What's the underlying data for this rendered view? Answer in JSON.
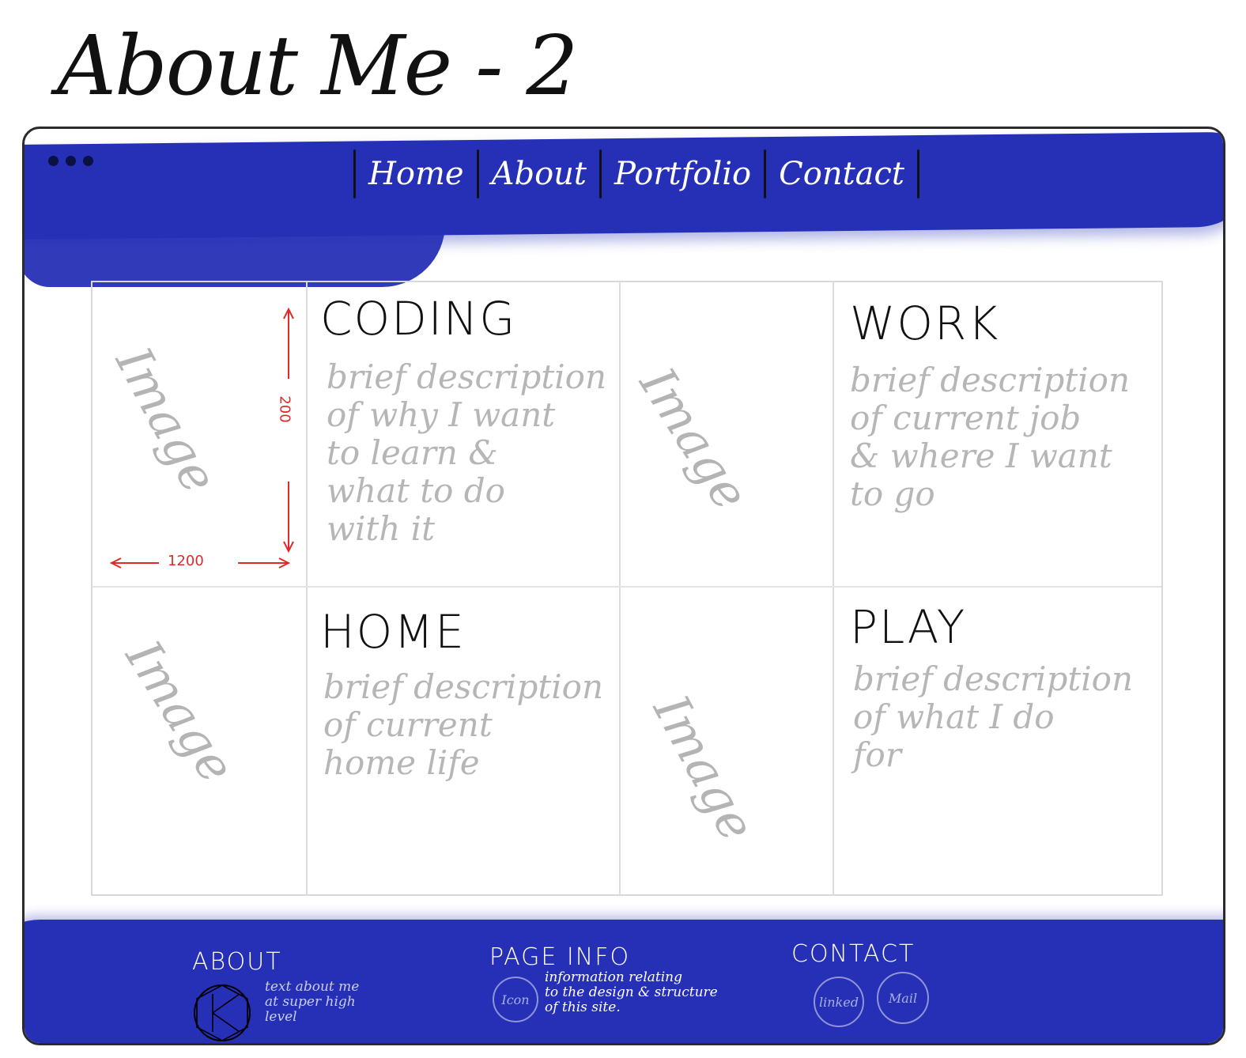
{
  "page_title": "About Me - 2",
  "nav": {
    "items": [
      "Home",
      "About",
      "Portfolio",
      "Contact"
    ]
  },
  "grid": {
    "image_label": "Image",
    "dimensions": {
      "width_label": "1200",
      "height_label": "200"
    },
    "sections": [
      {
        "title": "CODING",
        "description": "brief description\nof why I want\nto learn &\nwhat to do\nwith it"
      },
      {
        "title": "WORK",
        "description": "brief description\nof current job\n& where I want\nto go"
      },
      {
        "title": "HOME",
        "description": "brief description\nof current\nhome life"
      },
      {
        "title": "PLAY",
        "description": "brief description\nof what I do\nfor"
      }
    ]
  },
  "footer": {
    "about": {
      "heading": "ABOUT",
      "text": "text about me\nat super high\nlevel"
    },
    "page_info": {
      "heading": "PAGE INFO",
      "icon_label": "Icon",
      "text": "information relating\nto the design & structure\nof this site."
    },
    "contact": {
      "heading": "CONTACT",
      "linked_label": "linked",
      "mail_label": "Mail"
    }
  },
  "colors": {
    "band": "#2630b6",
    "sketch_gray": "#b6b6b6",
    "annotation_red": "#e02a2a"
  }
}
